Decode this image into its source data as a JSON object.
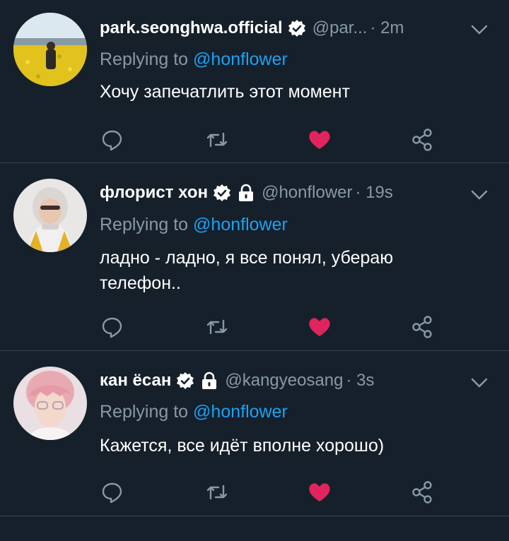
{
  "colors": {
    "background": "#15202b",
    "divider": "#38444d",
    "secondary_text": "#8899a6",
    "link": "#1da1f2",
    "like": "#e0245e"
  },
  "tweets": [
    {
      "name": "park.seonghwa.official",
      "verified": true,
      "protected": false,
      "handle": "@par...",
      "time": "· 2m",
      "replying_prefix": "Replying to",
      "replying_to": "@honflower",
      "text": "Хочу запечатлить этот момент",
      "liked": true,
      "avatar_icon": "yellow-flower-field-photo"
    },
    {
      "name": "флорист хон",
      "verified": true,
      "protected": true,
      "handle": "@honflower",
      "time": "· 19s",
      "replying_prefix": "Replying to",
      "replying_to": "@honflower",
      "text": "ладно - ладно, я все понял, убераю телефон..",
      "liked": true,
      "avatar_icon": "person-with-hood-photo"
    },
    {
      "name": "кан ёсан",
      "verified": true,
      "protected": true,
      "handle": "@kangyeosang",
      "time": "· 3s",
      "replying_prefix": "Replying to",
      "replying_to": "@honflower",
      "text": "Кажется, все идёт вполне хорошо)",
      "liked": true,
      "avatar_icon": "pink-hair-person-photo"
    }
  ],
  "icons": {
    "reply": "speech-bubble-icon",
    "retweet": "retweet-icon",
    "like": "heart-icon",
    "share": "share-icon",
    "menu": "chevron-down-icon",
    "verified": "verified-badge-icon",
    "protected": "lock-icon"
  }
}
